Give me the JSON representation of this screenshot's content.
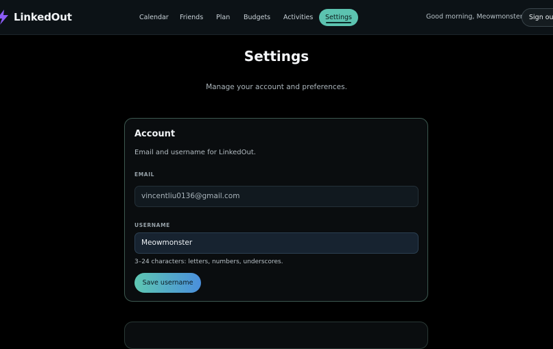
{
  "app": {
    "name": "LinkedOut"
  },
  "nav": {
    "items": [
      {
        "label": "Calendar"
      },
      {
        "label": "Friends"
      },
      {
        "label": "Plan"
      },
      {
        "label": "Budgets"
      },
      {
        "label": "Activities"
      },
      {
        "label": "Settings",
        "active": true
      }
    ]
  },
  "header": {
    "greeting": "Good morning, Meowmonster",
    "sign_out": "Sign out"
  },
  "page": {
    "title": "Settings",
    "subtitle": "Manage your account and preferences."
  },
  "account": {
    "title": "Account",
    "description": "Email and username for LinkedOut.",
    "email_label": "EMAIL",
    "email_value": "vincentliu0136@gmail.com",
    "username_label": "USERNAME",
    "username_value": "Meowmonster",
    "username_hint": "3–24 characters: letters, numbers, underscores.",
    "save_label": "Save username"
  },
  "colors": {
    "accent": "#5cc3b0",
    "brand_logo": "#8b5cf6",
    "background": "#000000"
  },
  "icons": {
    "logo": "lightning-bolt-icon"
  }
}
